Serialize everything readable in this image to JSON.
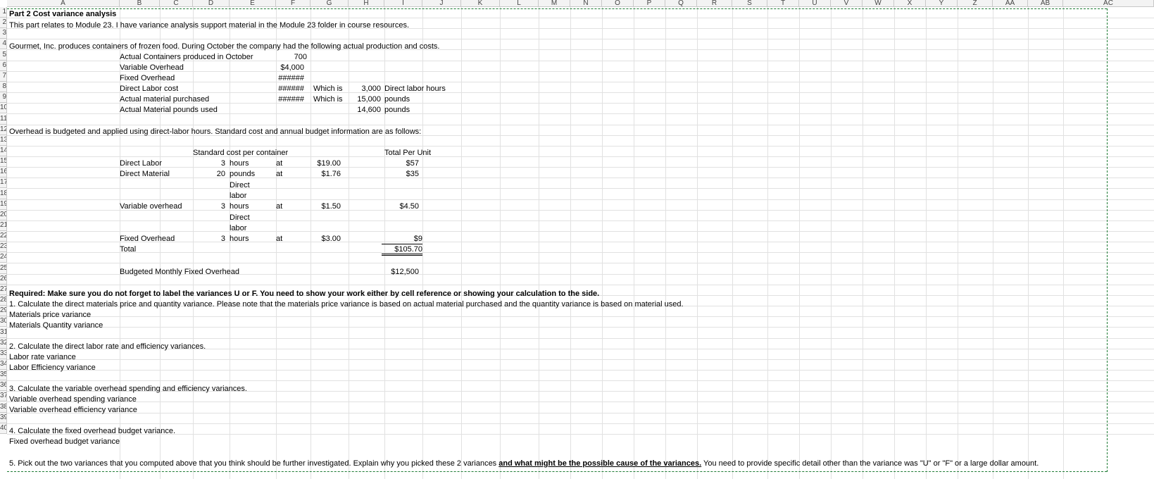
{
  "columns": [
    "A",
    "B",
    "C",
    "D",
    "E",
    "F",
    "G",
    "H",
    "I",
    "J",
    "K",
    "L",
    "M",
    "N",
    "O",
    "P",
    "Q",
    "R",
    "S",
    "T",
    "U",
    "V",
    "W",
    "X",
    "Y",
    "Z",
    "AA",
    "AB",
    "AC"
  ],
  "row_numbers": [
    "1",
    "2",
    "3",
    "4",
    "5",
    "6",
    "7",
    "8",
    "9",
    "10",
    "11",
    "12",
    "13",
    "14",
    "15",
    "16",
    "17",
    "18",
    "19",
    "20",
    "21",
    "22",
    "23",
    "24",
    "25",
    "26",
    "27",
    "28",
    "29",
    "30",
    "31",
    "32",
    "33",
    "34",
    "35",
    "36",
    "37",
    "38",
    "39",
    "40"
  ],
  "title": "Part 2 Cost variance analysis",
  "intro": "This part relates to Module 23.  I have  variance analysis support material in the Module 23 folder in course resources.",
  "company_text": "Gourmet, Inc. produces containers of frozen food.  During October the company had the following actual production and costs.",
  "actuals": {
    "containers_label": "Actual Containers produced in October",
    "containers_value": "700",
    "var_oh_label": "Variable Overhead",
    "var_oh_value": "$4,000",
    "fixed_oh_label": "Fixed Overhead",
    "fixed_oh_value": "######",
    "dl_cost_label": "Direct Labor cost",
    "dl_cost_value": "######",
    "dl_which": "Which is",
    "dl_hours_value": "3,000",
    "dl_hours_unit": "Direct labor hours",
    "mat_purch_label": "Actual material purchased",
    "mat_purch_value": "######",
    "mat_which": "Which is",
    "mat_purch_qty": "15,000",
    "mat_purch_unit": "pounds",
    "mat_used_label": "Actual Material pounds used",
    "mat_used_qty": "14,600",
    "mat_used_unit": "pounds"
  },
  "overhead_text": "Overhead is budgeted and applied using direct-labor hours.  Standard cost and annual budget information are as follows:",
  "standard": {
    "header": "Standard cost per container",
    "total_header": "Total Per Unit",
    "at": "at",
    "dl_label": "Direct Labor",
    "dl_qty": "3",
    "dl_unit": "hours",
    "dl_rate": "$19.00",
    "dl_total": "$57",
    "dm_label": "Direct Material",
    "dm_qty": "20",
    "dm_unit": "pounds",
    "dm_rate": "$1.76",
    "dm_total": "$35",
    "vo_label": "Variable overhead",
    "vo_qty": "3",
    "vo_unit": "Direct labor hours",
    "vo_rate": "$1.50",
    "vo_total": "$4.50",
    "fo_label": "Fixed Overhead",
    "fo_qty": "3",
    "fo_unit": "Direct labor hours",
    "fo_rate": "$3.00",
    "fo_total": "$9",
    "total_label": "Total",
    "total_value": "$105.70",
    "budget_label": "Budgeted Monthly Fixed Overhead",
    "budget_value": "$12,500"
  },
  "required": {
    "heading": "Required:  Make sure you do not forget to label the variances U or F.  You need to show your work either by cell reference or showing your calculation to the side.",
    "q1": "1.  Calculate the  direct materials price and quantity variance.  Please note that the materials price variance is based on actual material purchased and the quantity variance is based on material used.",
    "q1a": "Materials price variance",
    "q1b": "Materials Quantity variance",
    "q2": "2.  Calculate the direct labor rate and efficiency variances.",
    "q2a": "Labor rate variance",
    "q2b": "Labor Efficiency variance",
    "q3": "3.  Calculate the variable overhead spending and efficiency variances.",
    "q3a": "Variable overhead spending variance",
    "q3b": "Variable overhead efficiency variance",
    "q4": "4.  Calculate the fixed overhead budget variance.",
    "q4a": "Fixed overhead budget variance",
    "q5_part1": "5.  Pick out the two variances that you computed above that you think should be further investigated.  Explain why you picked these 2 variances ",
    "q5_bold": "and what might be the possible cause of the variances.",
    "q5_part2": "  You need to provide specific detail other than the variance was \"U\" or \"F\" or a large dollar amount."
  }
}
